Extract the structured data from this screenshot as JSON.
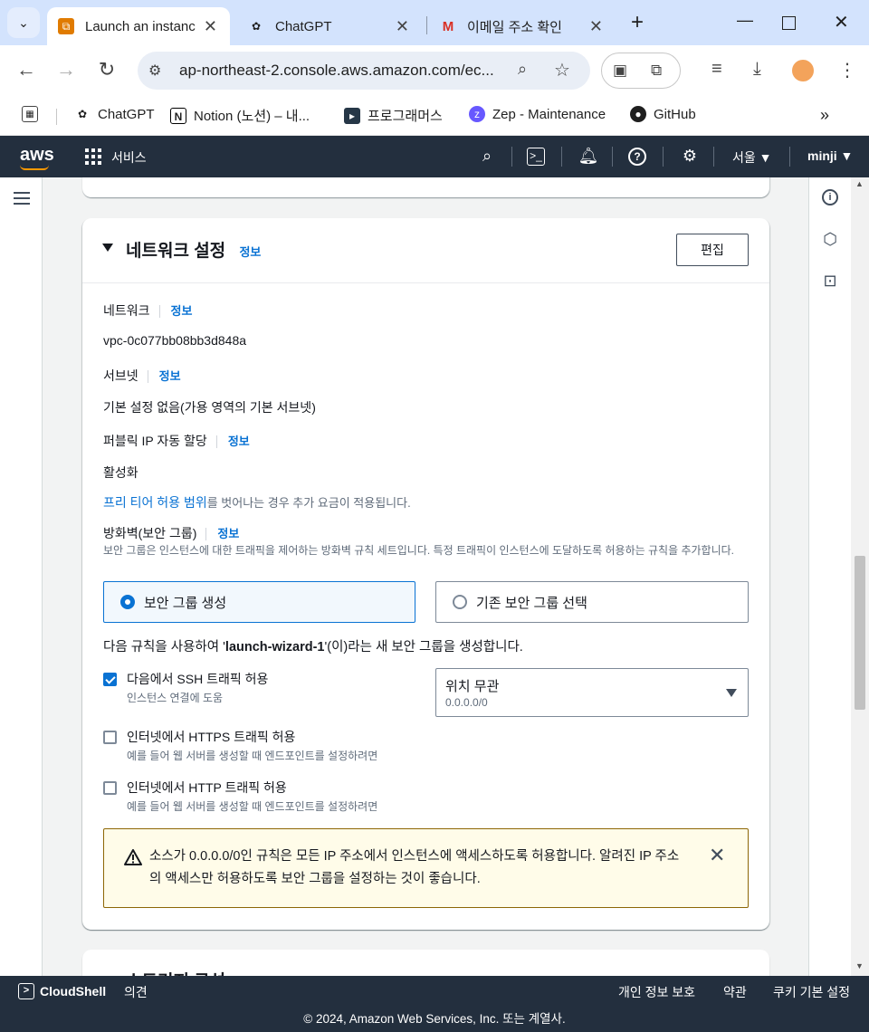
{
  "browser": {
    "tabs": [
      {
        "title": "Launch an instanc",
        "active": true
      },
      {
        "title": "ChatGPT",
        "active": false
      },
      {
        "title": "이메일 주소 확인",
        "active": false
      }
    ],
    "url": "ap-northeast-2.console.aws.amazon.com/ec...",
    "bookmarks": [
      {
        "label": "ChatGPT"
      },
      {
        "label": "Notion (노션) – 내..."
      },
      {
        "label": "프로그래머스"
      },
      {
        "label": "Zep - Maintenance"
      },
      {
        "label": "GitHub"
      }
    ],
    "bookmarks_more": "»"
  },
  "aws_header": {
    "logo": "aws",
    "services": "서비스",
    "region": "서울 ▼",
    "user": "minji ▼"
  },
  "network": {
    "title": "네트워크 설정",
    "info": "정보",
    "edit": "편집",
    "network_label": "네트워크",
    "network_value": "vpc-0c077bb08bb3d848a",
    "subnet_label": "서브넷",
    "subnet_value": "기본 설정 없음(가용 영역의 기본 서브넷)",
    "public_ip_label": "퍼블릭 IP 자동 할당",
    "public_ip_value": "활성화",
    "free_tier_link": "프리 티어 허용 범위",
    "free_tier_note": "를 벗어나는 경우 추가 요금이 적용됩니다.",
    "firewall_label": "방화벽(보안 그룹)",
    "firewall_desc": "보안 그룹은 인스턴스에 대한 트래픽을 제어하는 방화벽 규칙 세트입니다. 특정 트래픽이 인스턴스에 도달하도록 허용하는 규칙을 추가합니다.",
    "option_create": "보안 그룹 생성",
    "option_existing": "기존 보안 그룹 선택",
    "create_note_prefix": "다음 규칙을 사용하여 '",
    "create_note_name": "launch-wizard-1",
    "create_note_suffix": "'(이)라는 새 보안 그룹을 생성합니다.",
    "rules": [
      {
        "label": "다음에서 SSH 트래픽 허용",
        "sub": "인스턴스 연결에 도움",
        "checked": true
      },
      {
        "label": "인터넷에서 HTTPS 트래픽 허용",
        "sub": "예를 들어 웹 서버를 생성할 때 엔드포인트를 설정하려면",
        "checked": false
      },
      {
        "label": "인터넷에서 HTTP 트래픽 허용",
        "sub": "예를 들어 웹 서버를 생성할 때 엔드포인트를 설정하려면",
        "checked": false
      }
    ],
    "source_select": {
      "value": "위치 무관",
      "sub": "0.0.0.0/0"
    },
    "warning": "소스가 0.0.0.0/0인 규칙은 모든 IP 주소에서 인스턴스에 액세스하도록 허용합니다. 알려진 IP 주소의 액세스만 허용하도록 보안 그룹을 설정하는 것이 좋습니다."
  },
  "next_section_title": "스토리지 구성",
  "footer": {
    "cloudshell": "CloudShell",
    "feedback": "의견",
    "privacy": "개인 정보 보호",
    "terms": "약관",
    "cookies": "쿠키 기본 설정",
    "copyright": "© 2024, Amazon Web Services, Inc. 또는 계열사."
  },
  "colors": {
    "aws_nav": "#232f3e",
    "link": "#0972d3",
    "warning_bg": "#fffce9",
    "warning_border": "#8d6605"
  }
}
